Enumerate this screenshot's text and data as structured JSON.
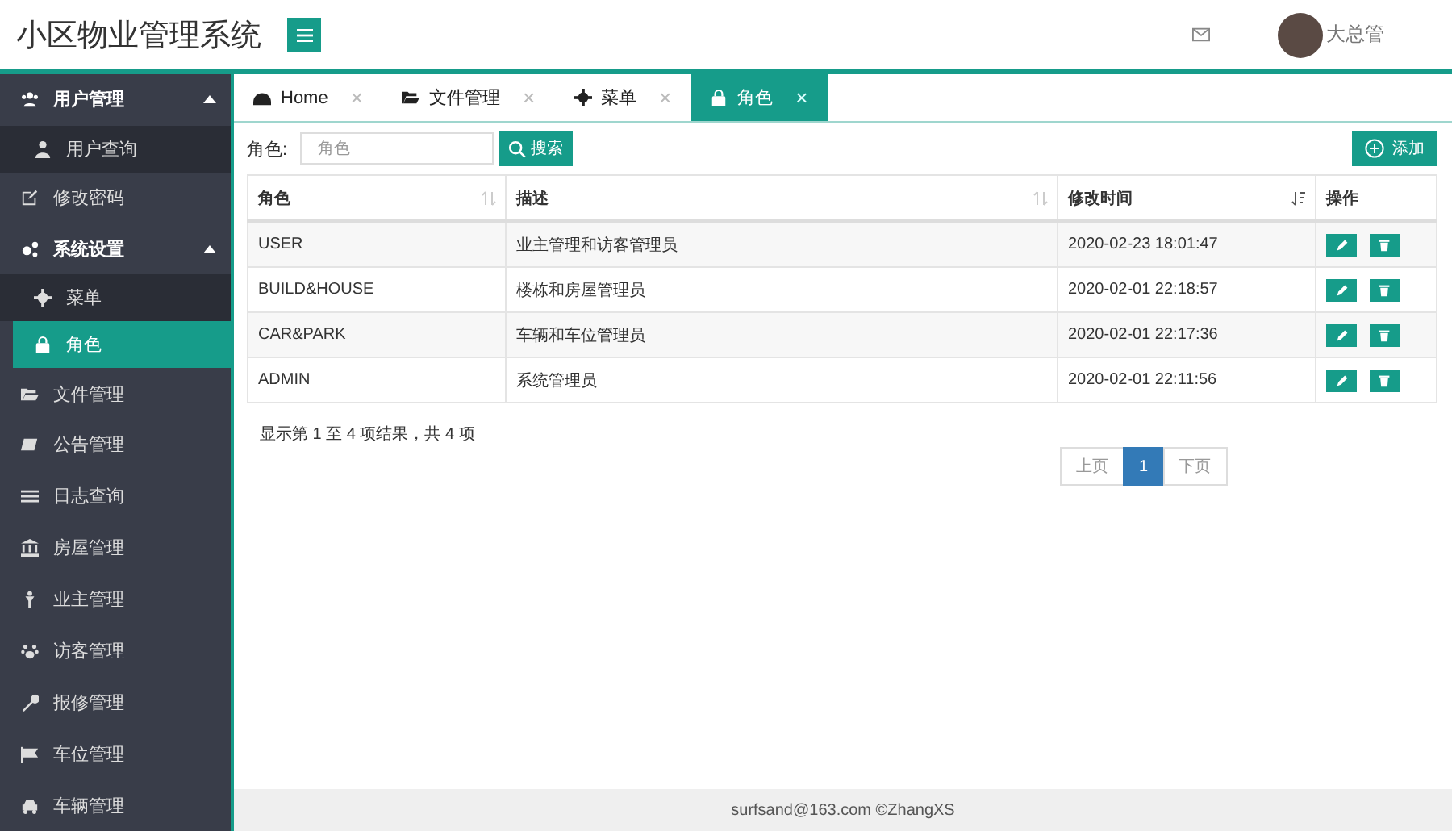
{
  "header": {
    "title": "小区物业管理系统",
    "user": "大总管"
  },
  "sidebar": {
    "items": [
      {
        "label": "用户管理",
        "expanded": true,
        "selected": false,
        "children": [
          {
            "label": "用户查询",
            "selected": false
          }
        ]
      },
      {
        "label": "修改密码",
        "selected": false
      },
      {
        "label": "系统设置",
        "expanded": true,
        "selected": false,
        "children": [
          {
            "label": "菜单",
            "selected": false
          },
          {
            "label": "角色",
            "selected": true
          }
        ]
      },
      {
        "label": "文件管理",
        "selected": false
      },
      {
        "label": "公告管理",
        "selected": false
      },
      {
        "label": "日志查询",
        "selected": false
      },
      {
        "label": "房屋管理",
        "selected": false
      },
      {
        "label": "业主管理",
        "selected": false
      },
      {
        "label": "访客管理",
        "selected": false
      },
      {
        "label": "报修管理",
        "selected": false
      },
      {
        "label": "车位管理",
        "selected": false
      },
      {
        "label": "车辆管理",
        "selected": false
      }
    ]
  },
  "tabs": [
    {
      "label": "Home",
      "selected": false,
      "close": "×"
    },
    {
      "label": "文件管理",
      "selected": false,
      "close": "×"
    },
    {
      "label": "菜单",
      "selected": false,
      "close": "×"
    },
    {
      "label": "角色",
      "selected": true,
      "close": "×"
    }
  ],
  "search": {
    "label": "角色:",
    "placeholder": "角色",
    "button": "搜索"
  },
  "add_button": "添加",
  "table": {
    "columns": [
      {
        "label": "角色",
        "sortable": true,
        "sorted": false
      },
      {
        "label": "描述",
        "sortable": true,
        "sorted": false
      },
      {
        "label": "修改时间",
        "sortable": true,
        "sorted": true
      },
      {
        "label": "操作",
        "sortable": false,
        "sorted": false
      }
    ],
    "rows": [
      {
        "role": "USER",
        "description": "业主管理和访客管理员",
        "modified": "2020-02-23 18:01:47"
      },
      {
        "role": "BUILD&HOUSE",
        "description": "楼栋和房屋管理员",
        "modified": "2020-02-01 22:18:57"
      },
      {
        "role": "CAR&PARK",
        "description": "车辆和车位管理员",
        "modified": "2020-02-01 22:17:36"
      },
      {
        "role": "ADMIN",
        "description": "系统管理员",
        "modified": "2020-02-01 22:11:56"
      }
    ]
  },
  "summary": "显示第 1 至 4 项结果，共 4 项",
  "pagination": {
    "prev": "上页",
    "pages": [
      {
        "label": "1",
        "selected": true
      }
    ],
    "next": "下页"
  },
  "footer": "surfsand@163.com ©ZhangXS"
}
